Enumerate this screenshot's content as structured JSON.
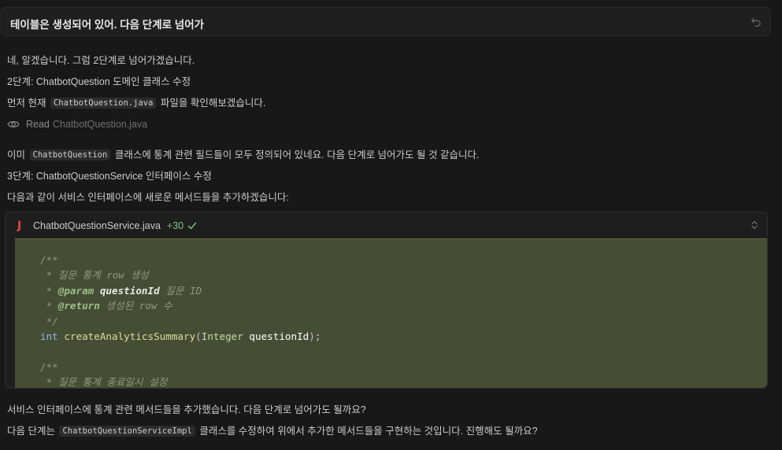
{
  "user_message": "테이블은 생성되어 있어. 다음 단계로 넘어가",
  "reply": {
    "line1": "네, 알겠습니다. 그럼 2단계로 넘어가겠습니다.",
    "line2": "2단계: ChatbotQuestion 도메인 클래스 수정",
    "line3_pre": "먼저 현재",
    "line3_chip": "ChatbotQuestion.java",
    "line3_post": "파일을 확인해보겠습니다.",
    "read_label": "Read",
    "read_file": "ChatbotQuestion.java",
    "line4_pre": "이미",
    "line4_chip": "ChatbotQuestion",
    "line4_post": "클래스에 통계 관련 필드들이 모두 정의되어 있네요. 다음 단계로 넘어가도 될 것 같습니다.",
    "line5": "3단계: ChatbotQuestionService 인터페이스 수정",
    "line6": "다음과 같이 서비스 인터페이스에 새로운 메서드들을 추가하겠습니다:",
    "line7": "서비스 인터페이스에 통계 관련 메서드들을 추가했습니다. 다음 단계로 넘어가도 될까요?",
    "line8_pre": "다음 단계는",
    "line8_chip": "ChatbotQuestionServiceImpl",
    "line8_post": "클래스를 수정하여 위에서 추가한 메서드들을 구현하는 것입니다. 진행해도 될까요?"
  },
  "code_block": {
    "icon": "java-icon",
    "filename": "ChatbotQuestionService.java",
    "added": "+30",
    "code": {
      "c_open1": "/**",
      "c_line1": " * 질문 통계 row 생성",
      "c_param_tag": "@param",
      "c_param_name": "questionId",
      "c_param_desc": "질문 ID",
      "c_return_tag": "@return",
      "c_return_desc": "생성된 row 수",
      "c_close1": " */",
      "sig_kw": "int",
      "sig_fn": "createAnalyticsSummary",
      "sig_type": "Integer",
      "sig_param": "questionId",
      "c_open2": "/**",
      "c_line2": " * 질문 통계 종료일시 설정"
    }
  },
  "colors": {
    "background": "#181818",
    "diff_added_bg": "#454d35",
    "java_icon": "#e2463f",
    "added_count": "#7fc47f"
  }
}
